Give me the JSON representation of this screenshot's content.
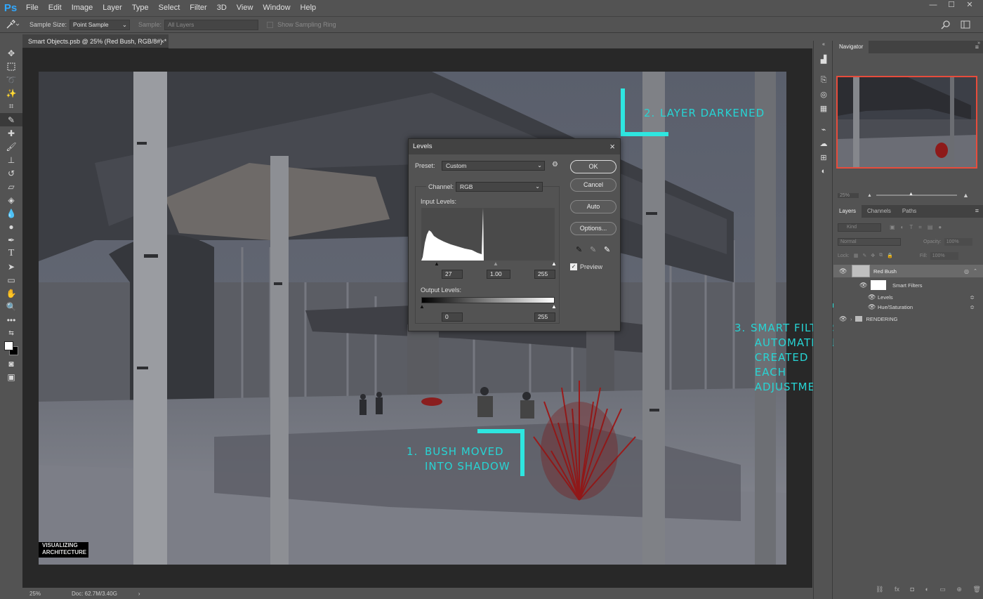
{
  "app": {
    "logo": "Ps"
  },
  "menu": [
    "File",
    "Edit",
    "Image",
    "Layer",
    "Type",
    "Select",
    "Filter",
    "3D",
    "View",
    "Window",
    "Help"
  ],
  "window_controls": [
    "—",
    "☐",
    "✕"
  ],
  "options_bar": {
    "sample_size_label": "Sample Size:",
    "sample_size_value": "Point Sample",
    "sample_label": "Sample:",
    "sample_value": "All Layers",
    "show_ring": "Show Sampling Ring"
  },
  "document": {
    "tab_title": "Smart Objects.psb @ 25% (Red Bush, RGB/8#) *",
    "zoom": "25%",
    "doc_size": "Doc: 62.7M/3.40G"
  },
  "levels_dialog": {
    "title": "Levels",
    "preset_label": "Preset:",
    "preset_value": "Custom",
    "channel_label": "Channel:",
    "channel_value": "RGB",
    "input_levels_label": "Input Levels:",
    "input_black": "27",
    "input_gamma": "1.00",
    "input_white": "255",
    "output_levels_label": "Output Levels:",
    "output_black": "0",
    "output_white": "255",
    "buttons": {
      "ok": "OK",
      "cancel": "Cancel",
      "auto": "Auto",
      "options": "Options..."
    },
    "preview_label": "Preview",
    "preview_checked": true
  },
  "navigator": {
    "title": "Navigator",
    "zoom": "25%"
  },
  "layers_panel": {
    "tabs": [
      "Layers",
      "Channels",
      "Paths"
    ],
    "filter_placeholder": "Kind",
    "blend_mode": "Normal",
    "opacity_label": "Opacity:",
    "opacity_value": "100%",
    "lock_label": "Lock:",
    "fill_label": "Fill:",
    "fill_value": "100%",
    "layers": [
      {
        "name": "Red Bush",
        "kind": "smart-object"
      },
      {
        "name": "Smart Filters",
        "kind": "smart-filters"
      },
      {
        "name": "Levels",
        "kind": "filter"
      },
      {
        "name": "Hue/Saturation",
        "kind": "filter"
      },
      {
        "name": "RENDERING",
        "kind": "group"
      }
    ]
  },
  "watermark": {
    "line1": "VISUALIZING",
    "line2": "ARCHITECTURE"
  },
  "annotations": {
    "a1_num": "1.",
    "a1_text": "BUSH MOVED\nINTO SHADOW",
    "a2_num": "2.",
    "a2_text": "LAYER DARKENED",
    "a3_num": "3.",
    "a3_text": "SMART FILTERS\n AUTOMATICALLY\n CREATED OF\n EACH\n ADJUSTMENT",
    "color": "#27d4d4"
  },
  "colors": {
    "accent_cyan": "#2ee6e0",
    "nav_frame": "#e74c3c",
    "ps_blue": "#31a8ff"
  }
}
